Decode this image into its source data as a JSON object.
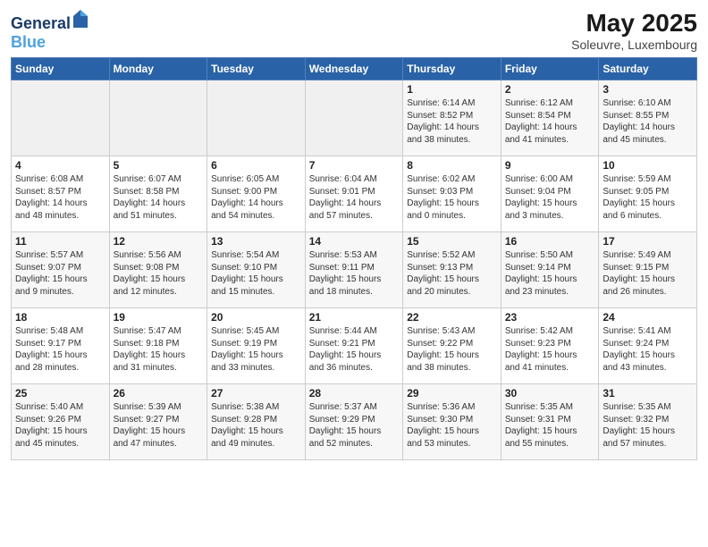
{
  "header": {
    "logo_line1": "General",
    "logo_line2": "Blue",
    "title": "May 2025",
    "subtitle": "Soleuvre, Luxembourg"
  },
  "weekdays": [
    "Sunday",
    "Monday",
    "Tuesday",
    "Wednesday",
    "Thursday",
    "Friday",
    "Saturday"
  ],
  "weeks": [
    [
      {
        "day": "",
        "info": ""
      },
      {
        "day": "",
        "info": ""
      },
      {
        "day": "",
        "info": ""
      },
      {
        "day": "",
        "info": ""
      },
      {
        "day": "1",
        "info": "Sunrise: 6:14 AM\nSunset: 8:52 PM\nDaylight: 14 hours\nand 38 minutes."
      },
      {
        "day": "2",
        "info": "Sunrise: 6:12 AM\nSunset: 8:54 PM\nDaylight: 14 hours\nand 41 minutes."
      },
      {
        "day": "3",
        "info": "Sunrise: 6:10 AM\nSunset: 8:55 PM\nDaylight: 14 hours\nand 45 minutes."
      }
    ],
    [
      {
        "day": "4",
        "info": "Sunrise: 6:08 AM\nSunset: 8:57 PM\nDaylight: 14 hours\nand 48 minutes."
      },
      {
        "day": "5",
        "info": "Sunrise: 6:07 AM\nSunset: 8:58 PM\nDaylight: 14 hours\nand 51 minutes."
      },
      {
        "day": "6",
        "info": "Sunrise: 6:05 AM\nSunset: 9:00 PM\nDaylight: 14 hours\nand 54 minutes."
      },
      {
        "day": "7",
        "info": "Sunrise: 6:04 AM\nSunset: 9:01 PM\nDaylight: 14 hours\nand 57 minutes."
      },
      {
        "day": "8",
        "info": "Sunrise: 6:02 AM\nSunset: 9:03 PM\nDaylight: 15 hours\nand 0 minutes."
      },
      {
        "day": "9",
        "info": "Sunrise: 6:00 AM\nSunset: 9:04 PM\nDaylight: 15 hours\nand 3 minutes."
      },
      {
        "day": "10",
        "info": "Sunrise: 5:59 AM\nSunset: 9:05 PM\nDaylight: 15 hours\nand 6 minutes."
      }
    ],
    [
      {
        "day": "11",
        "info": "Sunrise: 5:57 AM\nSunset: 9:07 PM\nDaylight: 15 hours\nand 9 minutes."
      },
      {
        "day": "12",
        "info": "Sunrise: 5:56 AM\nSunset: 9:08 PM\nDaylight: 15 hours\nand 12 minutes."
      },
      {
        "day": "13",
        "info": "Sunrise: 5:54 AM\nSunset: 9:10 PM\nDaylight: 15 hours\nand 15 minutes."
      },
      {
        "day": "14",
        "info": "Sunrise: 5:53 AM\nSunset: 9:11 PM\nDaylight: 15 hours\nand 18 minutes."
      },
      {
        "day": "15",
        "info": "Sunrise: 5:52 AM\nSunset: 9:13 PM\nDaylight: 15 hours\nand 20 minutes."
      },
      {
        "day": "16",
        "info": "Sunrise: 5:50 AM\nSunset: 9:14 PM\nDaylight: 15 hours\nand 23 minutes."
      },
      {
        "day": "17",
        "info": "Sunrise: 5:49 AM\nSunset: 9:15 PM\nDaylight: 15 hours\nand 26 minutes."
      }
    ],
    [
      {
        "day": "18",
        "info": "Sunrise: 5:48 AM\nSunset: 9:17 PM\nDaylight: 15 hours\nand 28 minutes."
      },
      {
        "day": "19",
        "info": "Sunrise: 5:47 AM\nSunset: 9:18 PM\nDaylight: 15 hours\nand 31 minutes."
      },
      {
        "day": "20",
        "info": "Sunrise: 5:45 AM\nSunset: 9:19 PM\nDaylight: 15 hours\nand 33 minutes."
      },
      {
        "day": "21",
        "info": "Sunrise: 5:44 AM\nSunset: 9:21 PM\nDaylight: 15 hours\nand 36 minutes."
      },
      {
        "day": "22",
        "info": "Sunrise: 5:43 AM\nSunset: 9:22 PM\nDaylight: 15 hours\nand 38 minutes."
      },
      {
        "day": "23",
        "info": "Sunrise: 5:42 AM\nSunset: 9:23 PM\nDaylight: 15 hours\nand 41 minutes."
      },
      {
        "day": "24",
        "info": "Sunrise: 5:41 AM\nSunset: 9:24 PM\nDaylight: 15 hours\nand 43 minutes."
      }
    ],
    [
      {
        "day": "25",
        "info": "Sunrise: 5:40 AM\nSunset: 9:26 PM\nDaylight: 15 hours\nand 45 minutes."
      },
      {
        "day": "26",
        "info": "Sunrise: 5:39 AM\nSunset: 9:27 PM\nDaylight: 15 hours\nand 47 minutes."
      },
      {
        "day": "27",
        "info": "Sunrise: 5:38 AM\nSunset: 9:28 PM\nDaylight: 15 hours\nand 49 minutes."
      },
      {
        "day": "28",
        "info": "Sunrise: 5:37 AM\nSunset: 9:29 PM\nDaylight: 15 hours\nand 52 minutes."
      },
      {
        "day": "29",
        "info": "Sunrise: 5:36 AM\nSunset: 9:30 PM\nDaylight: 15 hours\nand 53 minutes."
      },
      {
        "day": "30",
        "info": "Sunrise: 5:35 AM\nSunset: 9:31 PM\nDaylight: 15 hours\nand 55 minutes."
      },
      {
        "day": "31",
        "info": "Sunrise: 5:35 AM\nSunset: 9:32 PM\nDaylight: 15 hours\nand 57 minutes."
      }
    ]
  ]
}
